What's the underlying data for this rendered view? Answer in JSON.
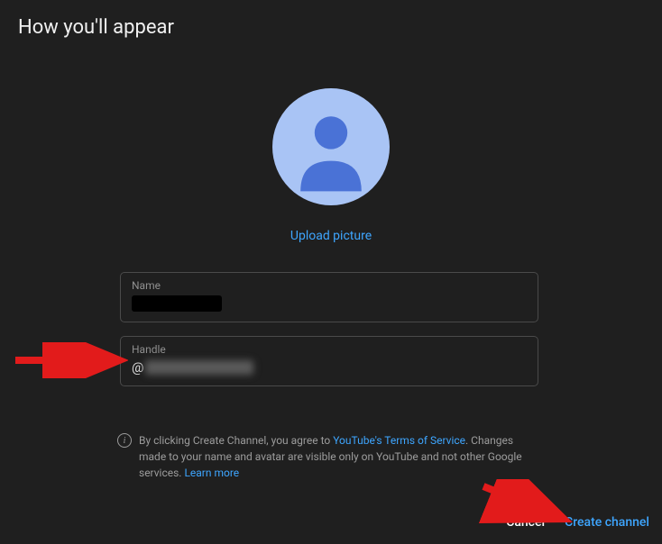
{
  "title": "How you'll appear",
  "upload_link": "Upload picture",
  "fields": {
    "name_label": "Name",
    "handle_label": "Handle",
    "handle_prefix": "@"
  },
  "info": {
    "pre": "By clicking Create Channel, you agree to ",
    "tos_link": "YouTube's Terms of Service",
    "mid": ". Changes made to your name and avatar are visible only on YouTube and not other Google services. ",
    "learn_more": "Learn more"
  },
  "buttons": {
    "cancel": "Cancel",
    "create": "Create channel"
  }
}
